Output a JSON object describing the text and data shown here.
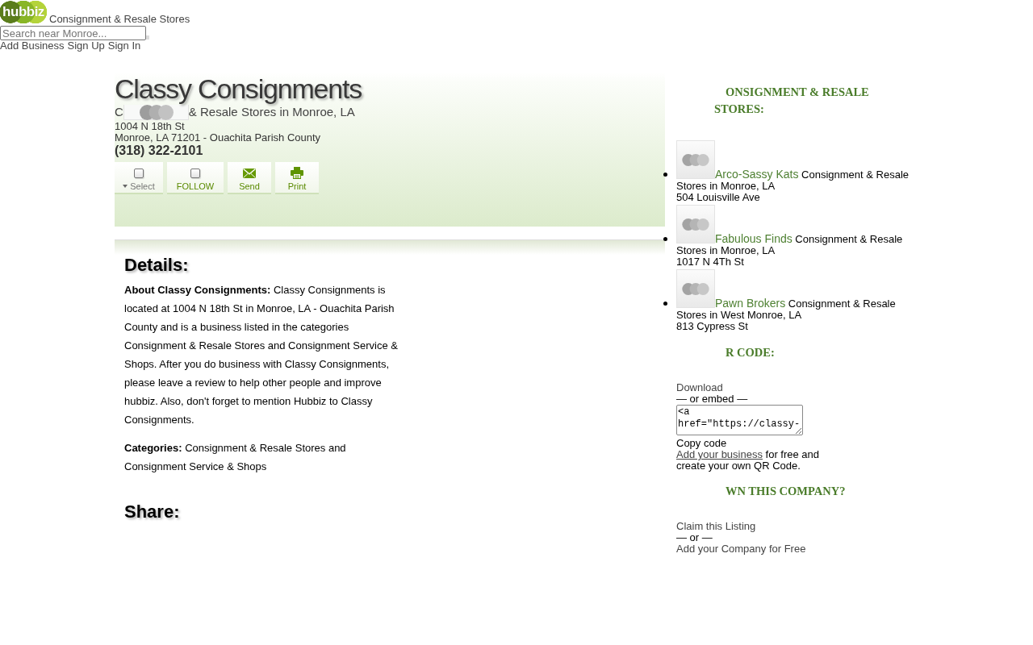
{
  "header": {
    "logo": "hubbiz",
    "category_link": "Consignment & Resale Stores",
    "search": {
      "placeholder": "Search near Monroe..."
    },
    "nav_links": [
      "Add Business",
      "Sign Up",
      "Sign In"
    ]
  },
  "business": {
    "name": "Classy Consignments",
    "category_line": {
      "visible_start": "C",
      "visible_end": "& Resale Stores in Monroe, LA"
    },
    "address_lines": [
      "1004 N 18th St",
      "Monroe, LA 71201 - Ouachita Parish County"
    ],
    "phone": "(318) 322-2101",
    "actions": [
      {
        "kind": "select",
        "label": "Select",
        "checked": false
      },
      {
        "kind": "follow",
        "label": "FOLLOW",
        "checked": false
      },
      {
        "kind": "send",
        "label": "Send"
      },
      {
        "kind": "print",
        "label": "Print"
      }
    ]
  },
  "details": {
    "heading": "Details:",
    "about": "**About Classy Consignments:** Classy Consignments is located at 1004 N 18th St in Monroe, LA - Ouachita Parish County and is a business listed in the categories Consignment & Resale Stores and Consignment Service & Shops. After you do business with Classy Consignments, please leave a review to help other people and improve hubbiz. Also, don't forget to mention Hubbiz to Classy Consignments.",
    "categories": "**Categories:** Consignment & Resale Stores and Consignment Service & Shops"
  },
  "share": {
    "heading": "Share:"
  },
  "sidebar": {
    "nearby": {
      "heading": "ONSIGNMENT & RESALE STORES:",
      "stores": [
        {
          "name": "Arco-Sassy Kats",
          "category": "Consignment & Resale Stores in Monroe, LA",
          "address": "504 Louisville Ave"
        },
        {
          "name": "Fabulous Finds",
          "category": "Consignment & Resale Stores in Monroe, LA",
          "address": "1017 N 4Th St"
        },
        {
          "name": "Pawn Brokers",
          "category": "Consignment & Resale Stores in West Monroe, LA",
          "address": "813 Cypress St"
        }
      ]
    },
    "qr_code": {
      "heading": "R CODE:",
      "download_link": "Download",
      "separator": "— or embed —",
      "embed_code": "<a href=\"https://classy-",
      "copy_label": "Copy code",
      "promo": {
        "link": "Add your business",
        "text": "for free and create your own QR Code."
      }
    },
    "ownership": {
      "heading": "WN THIS COMPANY?",
      "claim_link": "Claim this Listing",
      "separator": "— or —",
      "add_link": "Add your Company for Free"
    }
  }
}
